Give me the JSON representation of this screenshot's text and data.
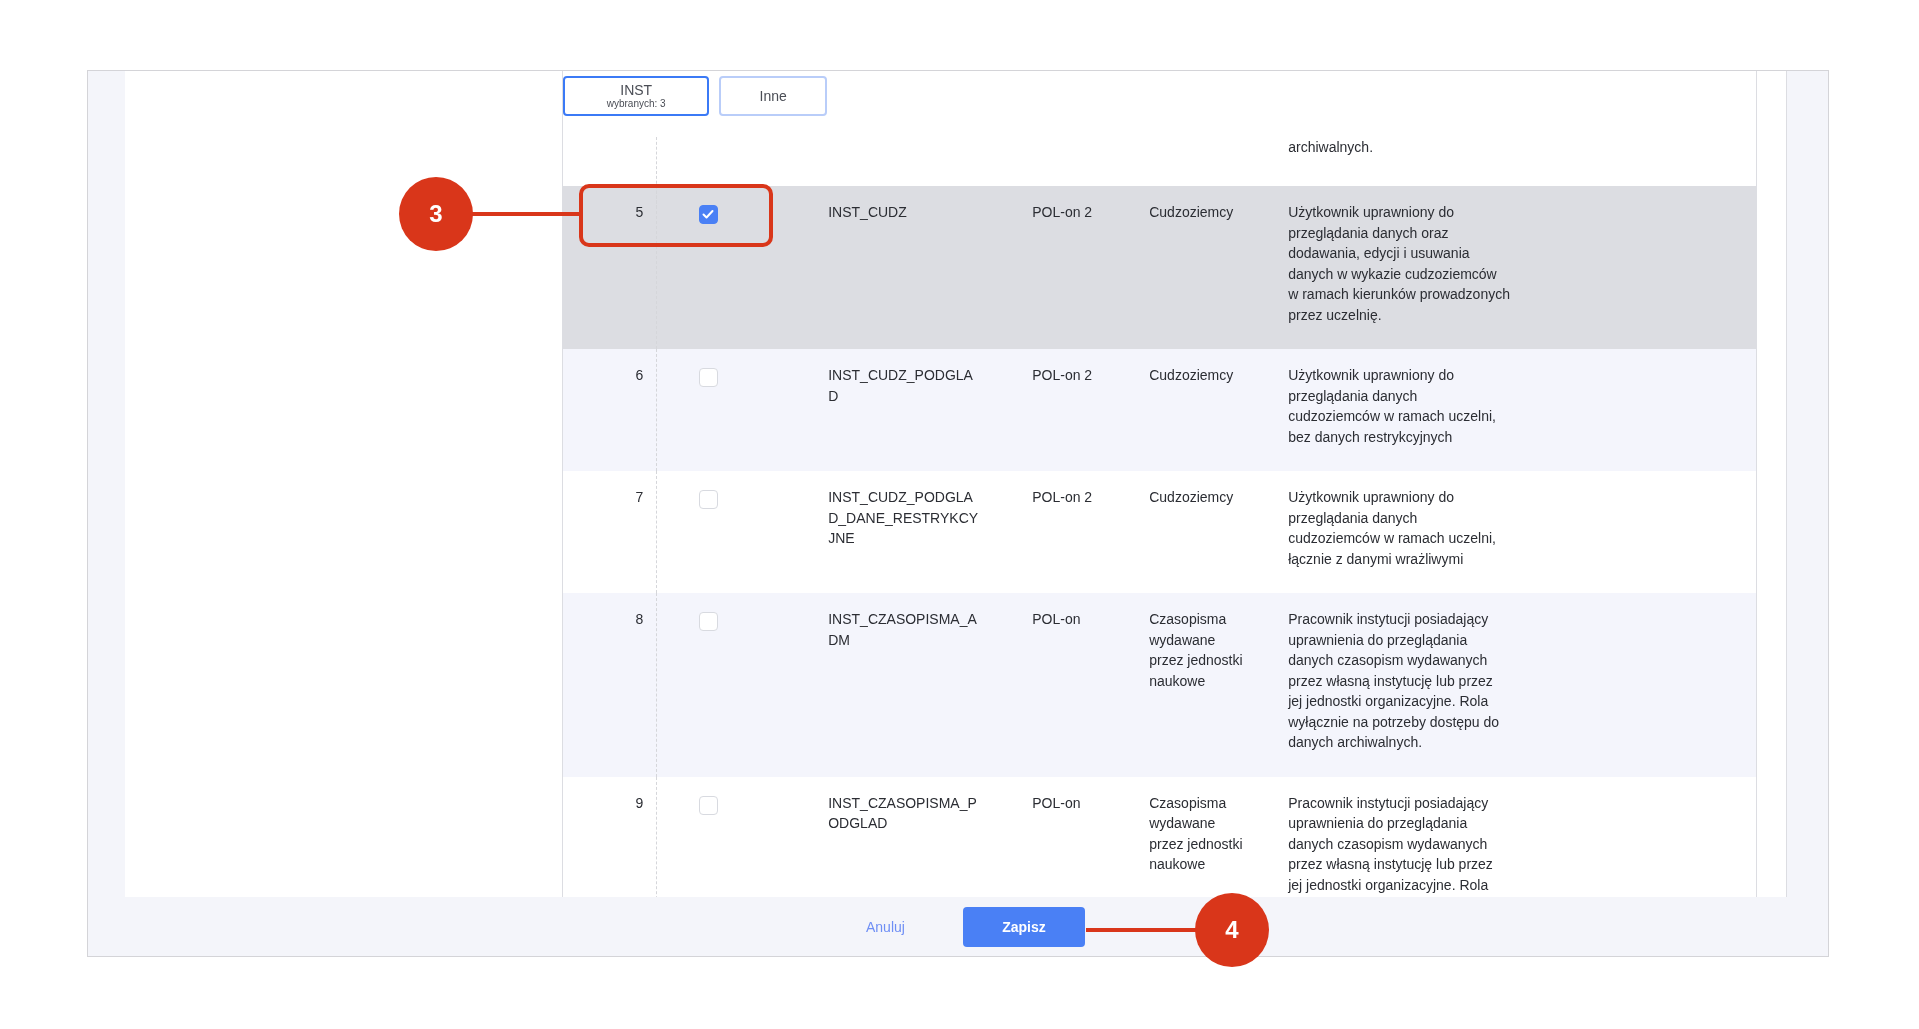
{
  "tabs": [
    {
      "label": "INST",
      "sublabel": "wybranych: 3",
      "selected": true
    },
    {
      "label": "Inne",
      "selected": false
    }
  ],
  "table": {
    "cut_off_text": "archiwalnych.",
    "rows": [
      {
        "number": "5",
        "checkbox": true,
        "code": "INST_CUDZ",
        "source": "POL-on 2",
        "category": "Cudzoziemcy",
        "description": "Użytkownik uprawniony do przeglądania danych oraz dodawania, edycji i usuwania danych w wykazie cudzoziemców w ramach kierunków prowadzonych przez uczelnię.",
        "highlighted": true
      },
      {
        "number": "6",
        "checkbox": false,
        "code": "INST_CUDZ_PODGLAD",
        "source": "POL-on 2",
        "category": "Cudzoziemcy",
        "description": "Użytkownik uprawniony do przeglądania danych cudzoziemców w ramach uczelni, bez danych restrykcyjnych",
        "highlighted": false
      },
      {
        "number": "7",
        "checkbox": false,
        "code": "INST_CUDZ_PODGLAD_DANE_RESTRYKCYJNE",
        "source": "POL-on 2",
        "category": "Cudzoziemcy",
        "description": "Użytkownik uprawniony do przeglądania danych cudzoziemców w ramach uczelni, łącznie z danymi wrażliwymi",
        "highlighted": false
      },
      {
        "number": "8",
        "checkbox": false,
        "code": "INST_CZASOPISMA_ADM",
        "source": "POL-on",
        "category": "Czasopisma wydawane przez jednostki naukowe",
        "description": "Pracownik instytucji posiadający uprawnienia do przeglądania danych czasopism wydawanych przez własną instytucję lub przez jej jednostki organizacyjne. Rola wyłącznie na potrzeby dostępu do danych archiwalnych.",
        "highlighted": false
      },
      {
        "number": "9",
        "checkbox": false,
        "code": "INST_CZASOPISMA_PODGLAD",
        "source": "POL-on",
        "category": "Czasopisma wydawane przez jednostki naukowe",
        "description": "Pracownik instytucji posiadający uprawnienia do przeglądania danych czasopism wydawanych przez własną instytucję lub przez jej jednostki organizacyjne. Rola",
        "highlighted": false
      }
    ]
  },
  "buttons": [
    {
      "label": "Anuluj",
      "kind": "link"
    },
    {
      "label": "Zapisz",
      "kind": "primary"
    }
  ],
  "callouts": [
    {
      "number": "3",
      "kind": "boxed"
    },
    {
      "number": "4",
      "kind": "plain"
    }
  ]
}
